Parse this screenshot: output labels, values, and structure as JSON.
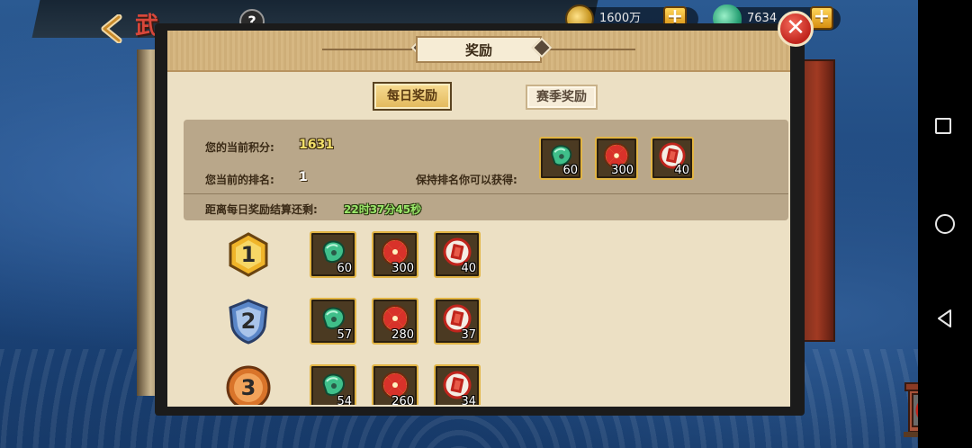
{
  "topbar": {
    "title": "武",
    "help_label": "?",
    "coin_amount": "1600万",
    "jade_amount": "7634",
    "plus_label": "+"
  },
  "dialog": {
    "title": "奖励",
    "close_label": "✕",
    "tabs": [
      {
        "label": "每日奖励",
        "active": true
      },
      {
        "label": "赛季奖励",
        "active": false
      }
    ],
    "info": {
      "score_label": "您的当前积分:",
      "score_value": "1631",
      "rank_label": "您当前的排名:",
      "rank_value": "1",
      "keep_label": "保持排名你可以获得:",
      "keep_rewards": [
        {
          "icon": "jade-icon",
          "qty": "60"
        },
        {
          "icon": "candy-icon",
          "qty": "300"
        },
        {
          "icon": "scroll-icon",
          "qty": "40"
        }
      ],
      "countdown_label": "距离每日奖励结算还剩:",
      "countdown_value": "22时37分45秒"
    },
    "ranks": [
      {
        "rank": "1",
        "medal_color": "#f0b52a",
        "rewards": [
          {
            "icon": "jade-icon",
            "qty": "60"
          },
          {
            "icon": "candy-icon",
            "qty": "300"
          },
          {
            "icon": "scroll-icon",
            "qty": "40"
          }
        ]
      },
      {
        "rank": "2",
        "medal_color": "#5a86c8",
        "rewards": [
          {
            "icon": "jade-icon",
            "qty": "57"
          },
          {
            "icon": "candy-icon",
            "qty": "280"
          },
          {
            "icon": "scroll-icon",
            "qty": "37"
          }
        ]
      },
      {
        "rank": "3",
        "medal_color": "#d9742a",
        "rewards": [
          {
            "icon": "jade-icon",
            "qty": "54"
          },
          {
            "icon": "candy-icon",
            "qty": "260"
          },
          {
            "icon": "scroll-icon",
            "qty": "34"
          }
        ]
      }
    ]
  },
  "system_nav": {
    "icons": [
      "recent-apps-icon",
      "home-icon",
      "back-icon"
    ]
  }
}
